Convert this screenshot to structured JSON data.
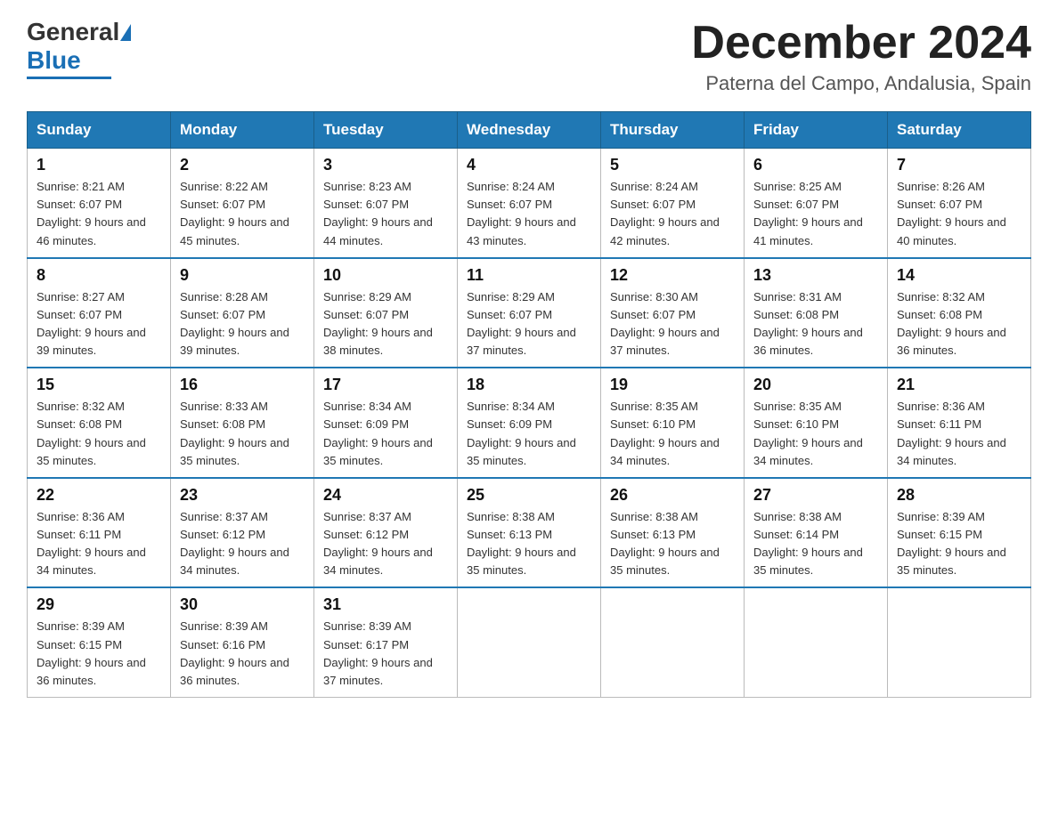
{
  "logo": {
    "general": "General",
    "blue": "Blue",
    "triangle": "▲"
  },
  "header": {
    "month_year": "December 2024",
    "location": "Paterna del Campo, Andalusia, Spain"
  },
  "days_of_week": [
    "Sunday",
    "Monday",
    "Tuesday",
    "Wednesday",
    "Thursday",
    "Friday",
    "Saturday"
  ],
  "weeks": [
    [
      {
        "day": "1",
        "sunrise": "Sunrise: 8:21 AM",
        "sunset": "Sunset: 6:07 PM",
        "daylight": "Daylight: 9 hours and 46 minutes."
      },
      {
        "day": "2",
        "sunrise": "Sunrise: 8:22 AM",
        "sunset": "Sunset: 6:07 PM",
        "daylight": "Daylight: 9 hours and 45 minutes."
      },
      {
        "day": "3",
        "sunrise": "Sunrise: 8:23 AM",
        "sunset": "Sunset: 6:07 PM",
        "daylight": "Daylight: 9 hours and 44 minutes."
      },
      {
        "day": "4",
        "sunrise": "Sunrise: 8:24 AM",
        "sunset": "Sunset: 6:07 PM",
        "daylight": "Daylight: 9 hours and 43 minutes."
      },
      {
        "day": "5",
        "sunrise": "Sunrise: 8:24 AM",
        "sunset": "Sunset: 6:07 PM",
        "daylight": "Daylight: 9 hours and 42 minutes."
      },
      {
        "day": "6",
        "sunrise": "Sunrise: 8:25 AM",
        "sunset": "Sunset: 6:07 PM",
        "daylight": "Daylight: 9 hours and 41 minutes."
      },
      {
        "day": "7",
        "sunrise": "Sunrise: 8:26 AM",
        "sunset": "Sunset: 6:07 PM",
        "daylight": "Daylight: 9 hours and 40 minutes."
      }
    ],
    [
      {
        "day": "8",
        "sunrise": "Sunrise: 8:27 AM",
        "sunset": "Sunset: 6:07 PM",
        "daylight": "Daylight: 9 hours and 39 minutes."
      },
      {
        "day": "9",
        "sunrise": "Sunrise: 8:28 AM",
        "sunset": "Sunset: 6:07 PM",
        "daylight": "Daylight: 9 hours and 39 minutes."
      },
      {
        "day": "10",
        "sunrise": "Sunrise: 8:29 AM",
        "sunset": "Sunset: 6:07 PM",
        "daylight": "Daylight: 9 hours and 38 minutes."
      },
      {
        "day": "11",
        "sunrise": "Sunrise: 8:29 AM",
        "sunset": "Sunset: 6:07 PM",
        "daylight": "Daylight: 9 hours and 37 minutes."
      },
      {
        "day": "12",
        "sunrise": "Sunrise: 8:30 AM",
        "sunset": "Sunset: 6:07 PM",
        "daylight": "Daylight: 9 hours and 37 minutes."
      },
      {
        "day": "13",
        "sunrise": "Sunrise: 8:31 AM",
        "sunset": "Sunset: 6:08 PM",
        "daylight": "Daylight: 9 hours and 36 minutes."
      },
      {
        "day": "14",
        "sunrise": "Sunrise: 8:32 AM",
        "sunset": "Sunset: 6:08 PM",
        "daylight": "Daylight: 9 hours and 36 minutes."
      }
    ],
    [
      {
        "day": "15",
        "sunrise": "Sunrise: 8:32 AM",
        "sunset": "Sunset: 6:08 PM",
        "daylight": "Daylight: 9 hours and 35 minutes."
      },
      {
        "day": "16",
        "sunrise": "Sunrise: 8:33 AM",
        "sunset": "Sunset: 6:08 PM",
        "daylight": "Daylight: 9 hours and 35 minutes."
      },
      {
        "day": "17",
        "sunrise": "Sunrise: 8:34 AM",
        "sunset": "Sunset: 6:09 PM",
        "daylight": "Daylight: 9 hours and 35 minutes."
      },
      {
        "day": "18",
        "sunrise": "Sunrise: 8:34 AM",
        "sunset": "Sunset: 6:09 PM",
        "daylight": "Daylight: 9 hours and 35 minutes."
      },
      {
        "day": "19",
        "sunrise": "Sunrise: 8:35 AM",
        "sunset": "Sunset: 6:10 PM",
        "daylight": "Daylight: 9 hours and 34 minutes."
      },
      {
        "day": "20",
        "sunrise": "Sunrise: 8:35 AM",
        "sunset": "Sunset: 6:10 PM",
        "daylight": "Daylight: 9 hours and 34 minutes."
      },
      {
        "day": "21",
        "sunrise": "Sunrise: 8:36 AM",
        "sunset": "Sunset: 6:11 PM",
        "daylight": "Daylight: 9 hours and 34 minutes."
      }
    ],
    [
      {
        "day": "22",
        "sunrise": "Sunrise: 8:36 AM",
        "sunset": "Sunset: 6:11 PM",
        "daylight": "Daylight: 9 hours and 34 minutes."
      },
      {
        "day": "23",
        "sunrise": "Sunrise: 8:37 AM",
        "sunset": "Sunset: 6:12 PM",
        "daylight": "Daylight: 9 hours and 34 minutes."
      },
      {
        "day": "24",
        "sunrise": "Sunrise: 8:37 AM",
        "sunset": "Sunset: 6:12 PM",
        "daylight": "Daylight: 9 hours and 34 minutes."
      },
      {
        "day": "25",
        "sunrise": "Sunrise: 8:38 AM",
        "sunset": "Sunset: 6:13 PM",
        "daylight": "Daylight: 9 hours and 35 minutes."
      },
      {
        "day": "26",
        "sunrise": "Sunrise: 8:38 AM",
        "sunset": "Sunset: 6:13 PM",
        "daylight": "Daylight: 9 hours and 35 minutes."
      },
      {
        "day": "27",
        "sunrise": "Sunrise: 8:38 AM",
        "sunset": "Sunset: 6:14 PM",
        "daylight": "Daylight: 9 hours and 35 minutes."
      },
      {
        "day": "28",
        "sunrise": "Sunrise: 8:39 AM",
        "sunset": "Sunset: 6:15 PM",
        "daylight": "Daylight: 9 hours and 35 minutes."
      }
    ],
    [
      {
        "day": "29",
        "sunrise": "Sunrise: 8:39 AM",
        "sunset": "Sunset: 6:15 PM",
        "daylight": "Daylight: 9 hours and 36 minutes."
      },
      {
        "day": "30",
        "sunrise": "Sunrise: 8:39 AM",
        "sunset": "Sunset: 6:16 PM",
        "daylight": "Daylight: 9 hours and 36 minutes."
      },
      {
        "day": "31",
        "sunrise": "Sunrise: 8:39 AM",
        "sunset": "Sunset: 6:17 PM",
        "daylight": "Daylight: 9 hours and 37 minutes."
      },
      null,
      null,
      null,
      null
    ]
  ]
}
